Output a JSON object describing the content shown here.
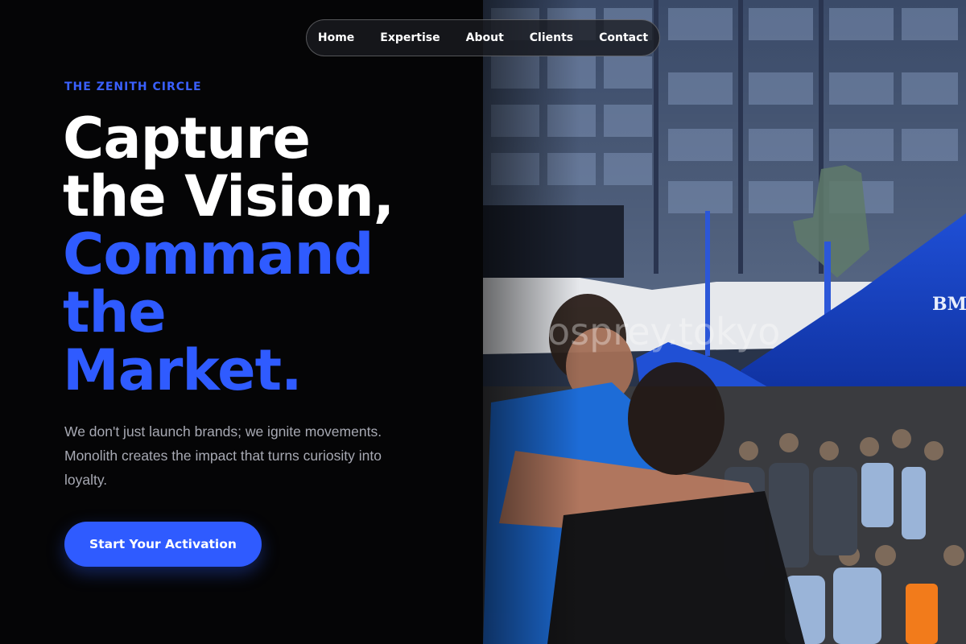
{
  "nav": {
    "items": [
      {
        "label": "Home"
      },
      {
        "label": "Expertise"
      },
      {
        "label": "About"
      },
      {
        "label": "Clients"
      },
      {
        "label": "Contact"
      }
    ]
  },
  "hero": {
    "eyebrow": "THE ZENITH CIRCLE",
    "headline_white": [
      "Capture",
      "the Vision,"
    ],
    "headline_blue": [
      "Command",
      "the",
      "Market."
    ],
    "subcopy": "We don't just launch brands; we ignite movements. Monolith creates the impact that turns curiosity into loyalty.",
    "cta_label": "Start Your Activation"
  },
  "photo": {
    "tent_brand_text": "BM",
    "watermark": "osprey.tokyo"
  },
  "colors": {
    "accent": "#2f5bff",
    "background": "#050506",
    "subcopy": "#a7a9b3"
  }
}
